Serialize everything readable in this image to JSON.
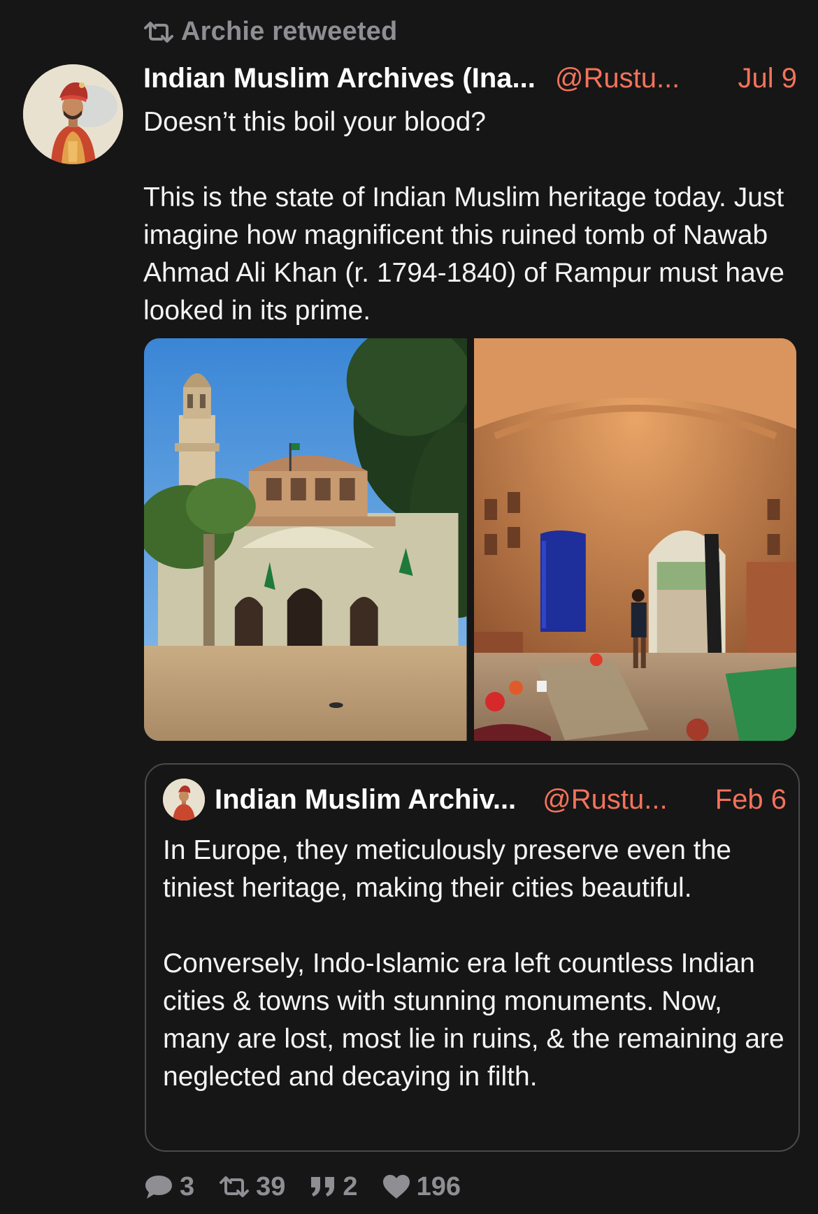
{
  "retweet": {
    "icon": "retweet-icon",
    "label": "Archie retweeted"
  },
  "tweet": {
    "author_name": "Indian Muslim Archives (Ina...",
    "handle": "@Rustu...",
    "date": "Jul 9",
    "avatar": "turbaned-man-portrait",
    "paragraphs": [
      "Doesn’t this boil your blood?",
      "This is the state of Indian Muslim heritage today. Just imagine how magnificent this ruined tomb of Nawab Ahmad Ali Khan (r. 1794-1840) of Rampur must have looked in its prime."
    ],
    "media": [
      "ruined tomb exterior with minaret",
      "ruined tomb interior"
    ]
  },
  "quote": {
    "author_name": "Indian Muslim Archiv...",
    "handle": "@Rustu...",
    "date": "Feb 6",
    "paragraphs": [
      "In Europe, they meticulously preserve even the tiniest heritage, making their cities beautiful.",
      "Conversely, Indo-Islamic era left countless Indian cities & towns with stunning monuments. Now, many are lost, most lie in ruins, & the remaining are neglected and decaying in filth."
    ]
  },
  "actions": {
    "replies": "3",
    "retweets": "39",
    "quotes": "2",
    "likes": "196",
    "icons": [
      "reply-icon",
      "retweet-icon",
      "quote-icon",
      "heart-icon"
    ]
  },
  "colors": {
    "background": "#161616",
    "accent": "#f2735b",
    "muted": "#8e8e93",
    "border": "#4a4a4e"
  }
}
